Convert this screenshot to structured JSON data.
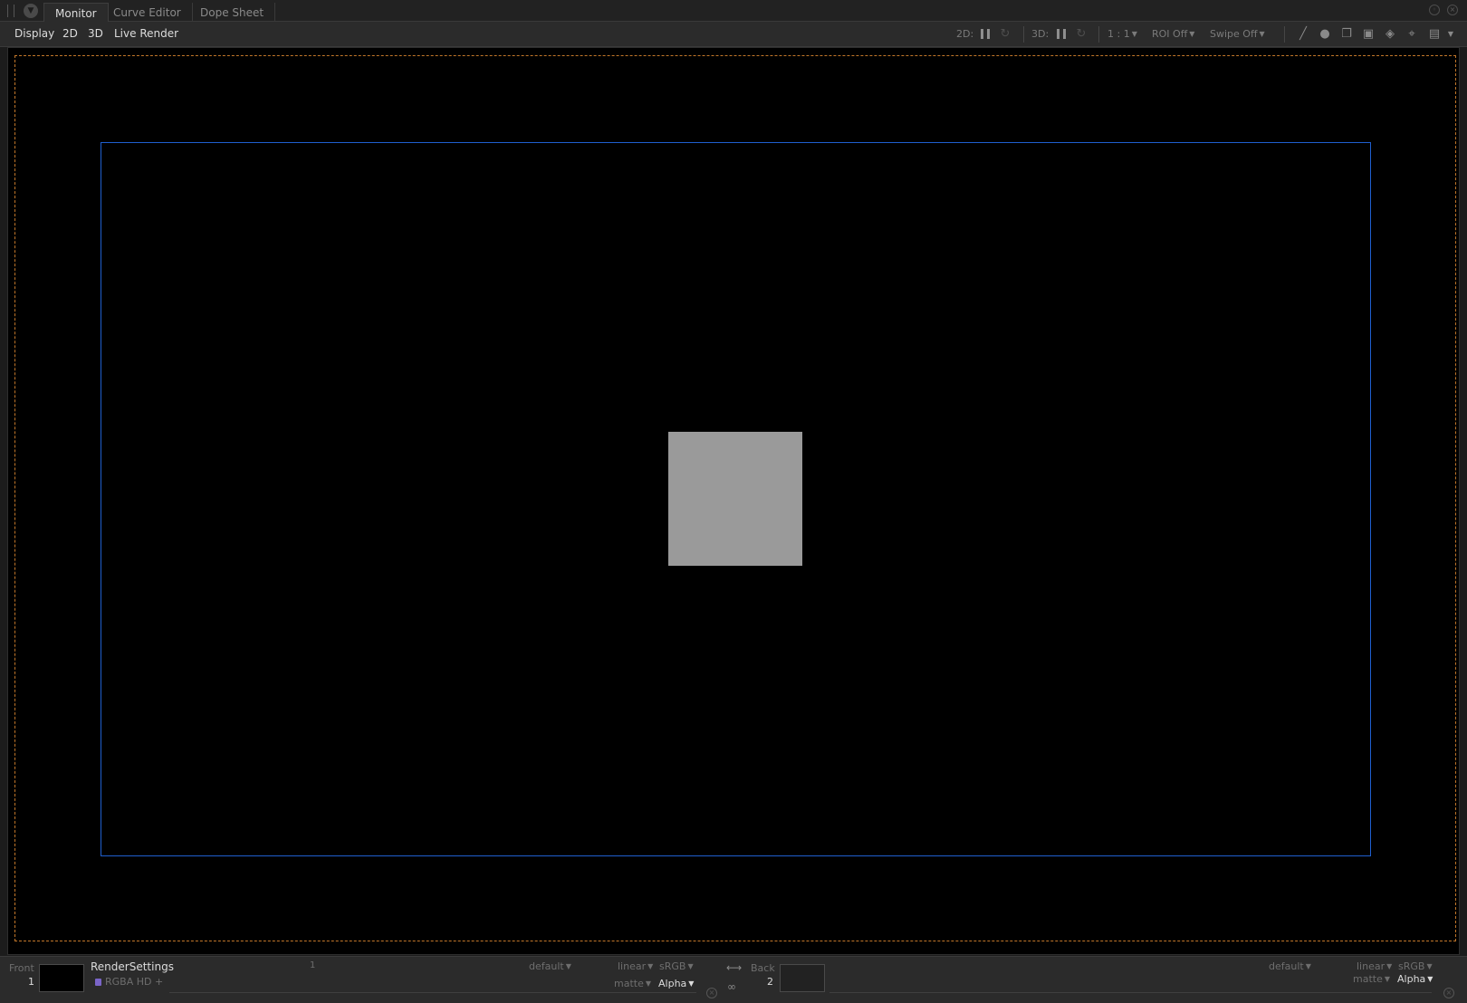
{
  "tabs": [
    {
      "label": "Monitor",
      "active": true
    },
    {
      "label": "Curve Editor",
      "active": false
    },
    {
      "label": "Dope Sheet",
      "active": false
    }
  ],
  "toolbar": {
    "menus": [
      "Display",
      "2D",
      "3D",
      "Live Render"
    ],
    "label_2d": "2D:",
    "label_3d": "3D:",
    "ratio": "1 : 1",
    "roi": "ROI Off",
    "swipe": "Swipe Off"
  },
  "viewer": {
    "safe_frame_color": "#c2772a",
    "format_frame_color": "#1f5fcf",
    "square_color": "#9a9a9a"
  },
  "front": {
    "label": "Front",
    "number": "1",
    "node_name": "RenderSettings",
    "channels": "RGBA",
    "format": "HD",
    "plus": "+",
    "frame": "1",
    "lut": "default",
    "colorspace_in": "linear",
    "colorspace_out": "sRGB",
    "matte": "matte",
    "channel_mode": "Alpha"
  },
  "back": {
    "label": "Back",
    "number": "2",
    "lut": "default",
    "colorspace_in": "linear",
    "colorspace_out": "sRGB",
    "matte": "matte",
    "channel_mode": "Alpha"
  }
}
